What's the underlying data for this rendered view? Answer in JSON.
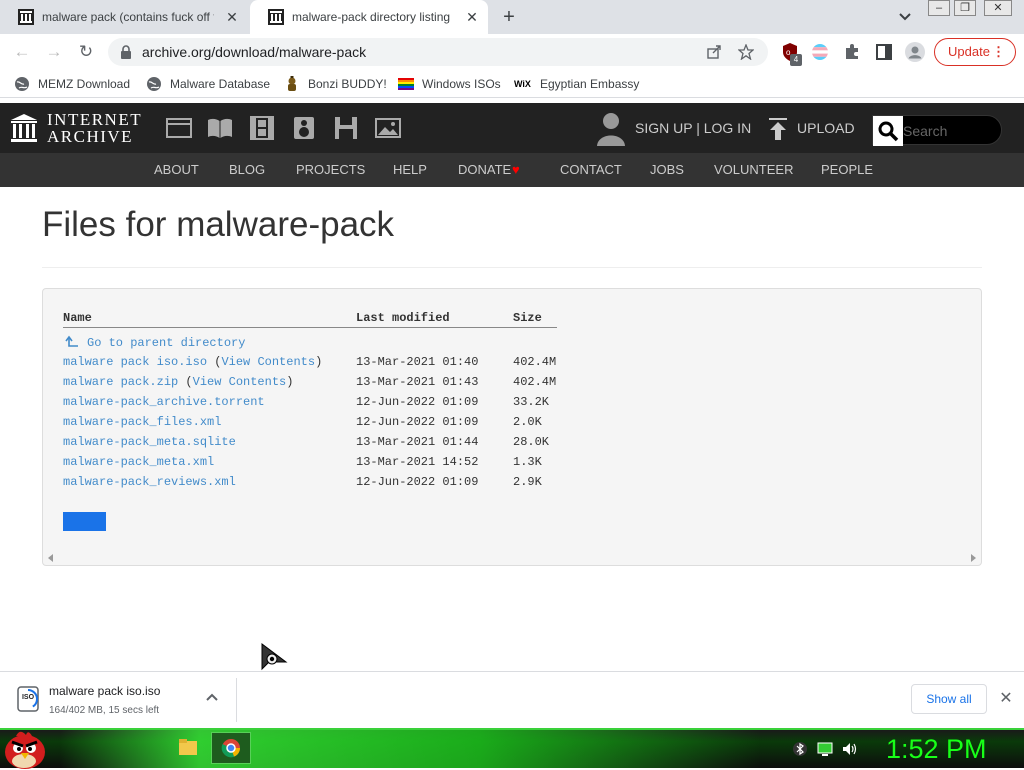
{
  "browser": {
    "tabs": [
      {
        "title": "malware pack (contains fuck off t",
        "active": false
      },
      {
        "title": "malware-pack directory listing",
        "active": true
      }
    ],
    "window_controls": {
      "minimize": "–",
      "maximize": "❐",
      "close": "✕"
    },
    "url": "archive.org/download/malware-pack",
    "update_label": "Update",
    "extension_badge": "4",
    "bookmarks": [
      {
        "label": "MEMZ Download",
        "icon": "globe-icon"
      },
      {
        "label": "Malware Database",
        "icon": "globe-icon"
      },
      {
        "label": "Bonzi BUDDY!",
        "icon": "bonzi-icon"
      },
      {
        "label": "Windows ISOs",
        "icon": "windows-flag-icon"
      },
      {
        "label": "Egyptian Embassy",
        "icon": "wix-icon"
      }
    ],
    "wix_text": "WiX"
  },
  "ia": {
    "logo_line1": "INTERNET",
    "logo_line2": "ARCHIVE",
    "signup": "SIGN UP | LOG IN",
    "upload": "UPLOAD",
    "search_placeholder": "Search",
    "nav": [
      "ABOUT",
      "BLOG",
      "PROJECTS",
      "HELP",
      "DONATE",
      "CONTACT",
      "JOBS",
      "VOLUNTEER",
      "PEOPLE"
    ]
  },
  "page": {
    "title": "Files for malware-pack",
    "columns": {
      "name": "Name",
      "modified": "Last modified",
      "size": "Size"
    },
    "parent_label": "Go to parent directory",
    "view_contents": "View Contents",
    "files": [
      {
        "name": "malware pack iso.iso",
        "view": true,
        "modified": "13-Mar-2021 01:40",
        "size": "402.4M"
      },
      {
        "name": "malware pack.zip",
        "view": true,
        "modified": "13-Mar-2021 01:43",
        "size": "402.4M"
      },
      {
        "name": "malware-pack_archive.torrent",
        "view": false,
        "modified": "12-Jun-2022 01:09",
        "size": "33.2K"
      },
      {
        "name": "malware-pack_files.xml",
        "view": false,
        "modified": "12-Jun-2022 01:09",
        "size": "2.0K"
      },
      {
        "name": "malware-pack_meta.sqlite",
        "view": false,
        "modified": "13-Mar-2021 01:44",
        "size": "28.0K"
      },
      {
        "name": "malware-pack_meta.xml",
        "view": false,
        "modified": "13-Mar-2021 14:52",
        "size": "1.3K"
      },
      {
        "name": "malware-pack_reviews.xml",
        "view": false,
        "modified": "12-Jun-2022 01:09",
        "size": "2.9K"
      }
    ]
  },
  "download": {
    "filename": "malware pack iso.iso",
    "status": "164/402 MB, 15 secs left",
    "icon_text": "ISO",
    "show_all": "Show all"
  },
  "taskbar": {
    "clock": "1:52 PM"
  },
  "colors": {
    "link": "#428bca",
    "ia_header": "#222222",
    "ia_nav": "#333333",
    "update_red": "#d93025",
    "clock_green": "#18ff18",
    "donate_heart": "#ff0000"
  }
}
